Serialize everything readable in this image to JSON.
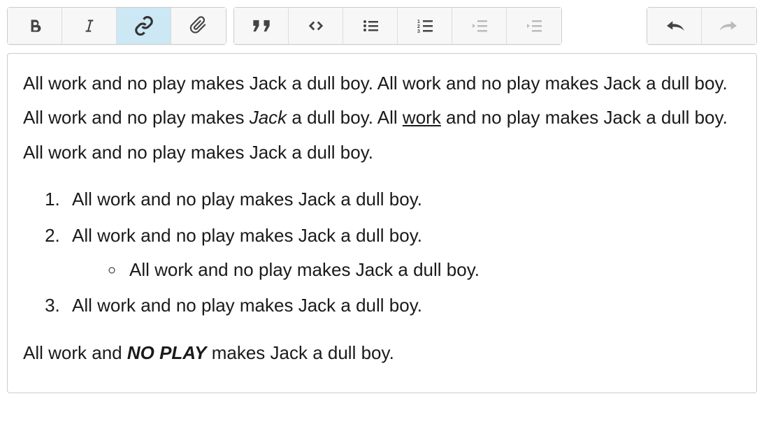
{
  "toolbar": {
    "group1": {
      "bold": "bold-icon",
      "italic": "italic-icon",
      "link": "link-icon",
      "attach": "attachment-icon"
    },
    "group2": {
      "quote": "quote-icon",
      "code": "code-icon",
      "ulist": "bullet-list-icon",
      "olist": "numbered-list-icon",
      "outdent": "outdent-icon",
      "indent": "indent-icon"
    },
    "group3": {
      "undo": "undo-icon",
      "redo": "redo-icon"
    },
    "active_button": "link"
  },
  "content": {
    "p1_part1": "All work and no play makes Jack a dull boy. All work and no play makes Jack a dull boy. All work and no play makes ",
    "p1_italic": "Jack",
    "p1_part2": " a dull boy. All ",
    "p1_underlined": "work",
    "p1_part3": " and no play makes Jack a dull boy. All work and no play makes Jack a dull boy.",
    "list": {
      "item1": "All work and no play makes Jack a dull boy.",
      "item2": "All work and no play makes Jack a dull boy.",
      "item2_sub1": "All work and no play makes Jack a dull boy.",
      "item3": "All work and no play makes Jack a dull boy."
    },
    "p2_part1": "All work and ",
    "p2_bolditalic": "NO PLAY",
    "p2_part2": " makes Jack a dull boy."
  }
}
